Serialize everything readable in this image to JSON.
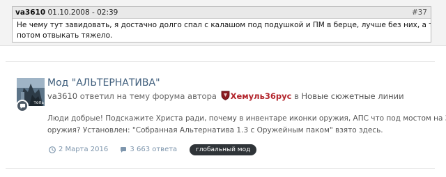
{
  "quote": {
    "author": "va3610",
    "date": "01.10.2008 - 02:39",
    "post_number": "#37",
    "line1": "Не чему тут завидовать, я достачно долго спал с калашом под подушкой и ПМ в берце, лучше без них, а то",
    "line2": "потом отвыкать тяжело."
  },
  "result": {
    "title": "Мод \"АЛЬТЕРНАТИВА\"",
    "avatar_icon": "user-avatar-photo",
    "avatar_caption": "топь",
    "badge_icon": "comment-bubble-icon",
    "meta": {
      "user": "va3610",
      "action": "ответил на тему форума автора",
      "author_icon": "shield-emblem-icon",
      "author": "Хемуль36рус",
      "in_text": "в",
      "forum": "Новые сюжетные линии"
    },
    "snippet": {
      "line1": "Люди добрые! Подскажите Христа ради, почему в инвентаре иконки оружия, АПС что под мостом на Затон",
      "line2": "оружия? Установлен: \"Собранная Альтернатива 1.3 с Оружейным паком\" взято здесь."
    },
    "footer": {
      "date": "2 Марта 2016",
      "replies": "3 663 ответа",
      "tag": "глобальный мод"
    }
  },
  "colors": {
    "link_blue": "#3f5e7c",
    "author_red": "#b3262d",
    "footer_blue": "#7e96ad",
    "tag_bg": "#2f3438"
  }
}
